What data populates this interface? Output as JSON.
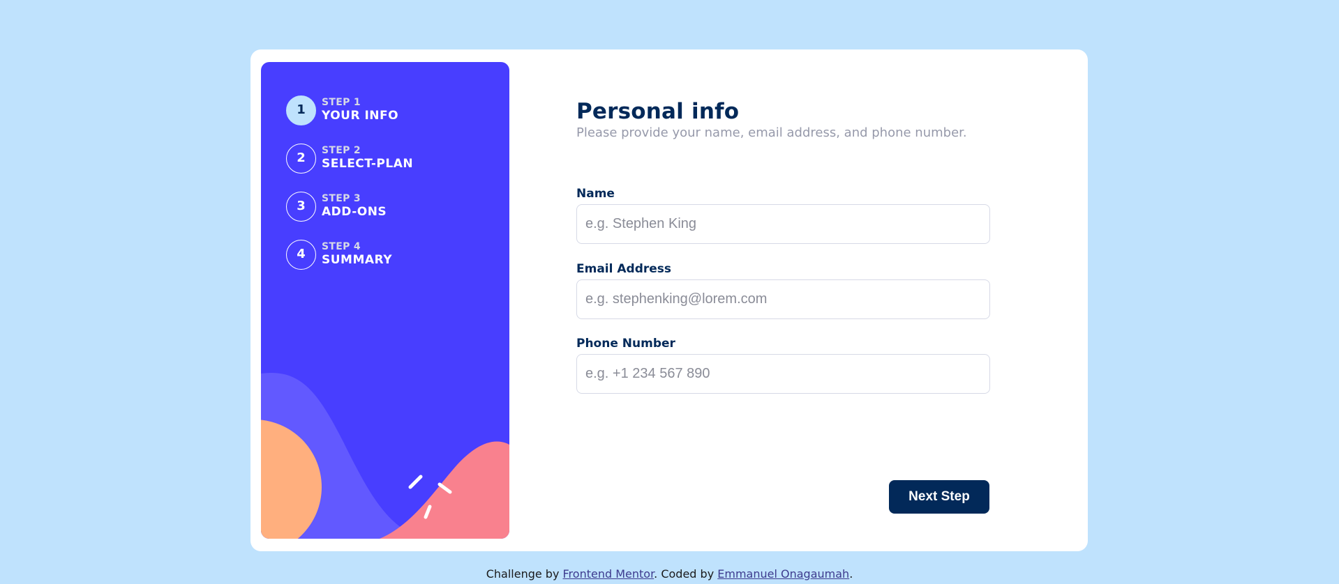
{
  "colors": {
    "page_background": "#bfe2fd",
    "card_background": "#ffffff",
    "sidebar_background": "#483eff",
    "accent_dark": "#022959",
    "active_step": "#bfe2fd",
    "muted_text": "#9699aa",
    "wave_violet": "#6259ff",
    "shape_orange": "#ffaf7e",
    "shape_pink": "#f9818e"
  },
  "sidebar": {
    "steps": [
      {
        "number": "1",
        "kicker": "STEP 1",
        "title": "YOUR INFO",
        "active": true
      },
      {
        "number": "2",
        "kicker": "STEP 2",
        "title": "SELECT-PLAN",
        "active": false
      },
      {
        "number": "3",
        "kicker": "STEP 3",
        "title": "ADD-ONS",
        "active": false
      },
      {
        "number": "4",
        "kicker": "STEP 4",
        "title": "SUMMARY",
        "active": false
      }
    ]
  },
  "main": {
    "title": "Personal info",
    "subtitle": "Please provide your name, email address, and phone number.",
    "fields": {
      "name": {
        "label": "Name",
        "placeholder": "e.g. Stephen King",
        "value": ""
      },
      "email": {
        "label": "Email Address",
        "placeholder": "e.g. stephenking@lorem.com",
        "value": ""
      },
      "phone": {
        "label": "Phone Number",
        "placeholder": "e.g. +1 234 567 890",
        "value": ""
      }
    },
    "next_button_label": "Next Step"
  },
  "footer": {
    "prefix": "Challenge by ",
    "challenge_link": "Frontend Mentor",
    "middle": ". Coded by ",
    "author_link": "Emmanuel Onagaumah",
    "suffix": "."
  }
}
